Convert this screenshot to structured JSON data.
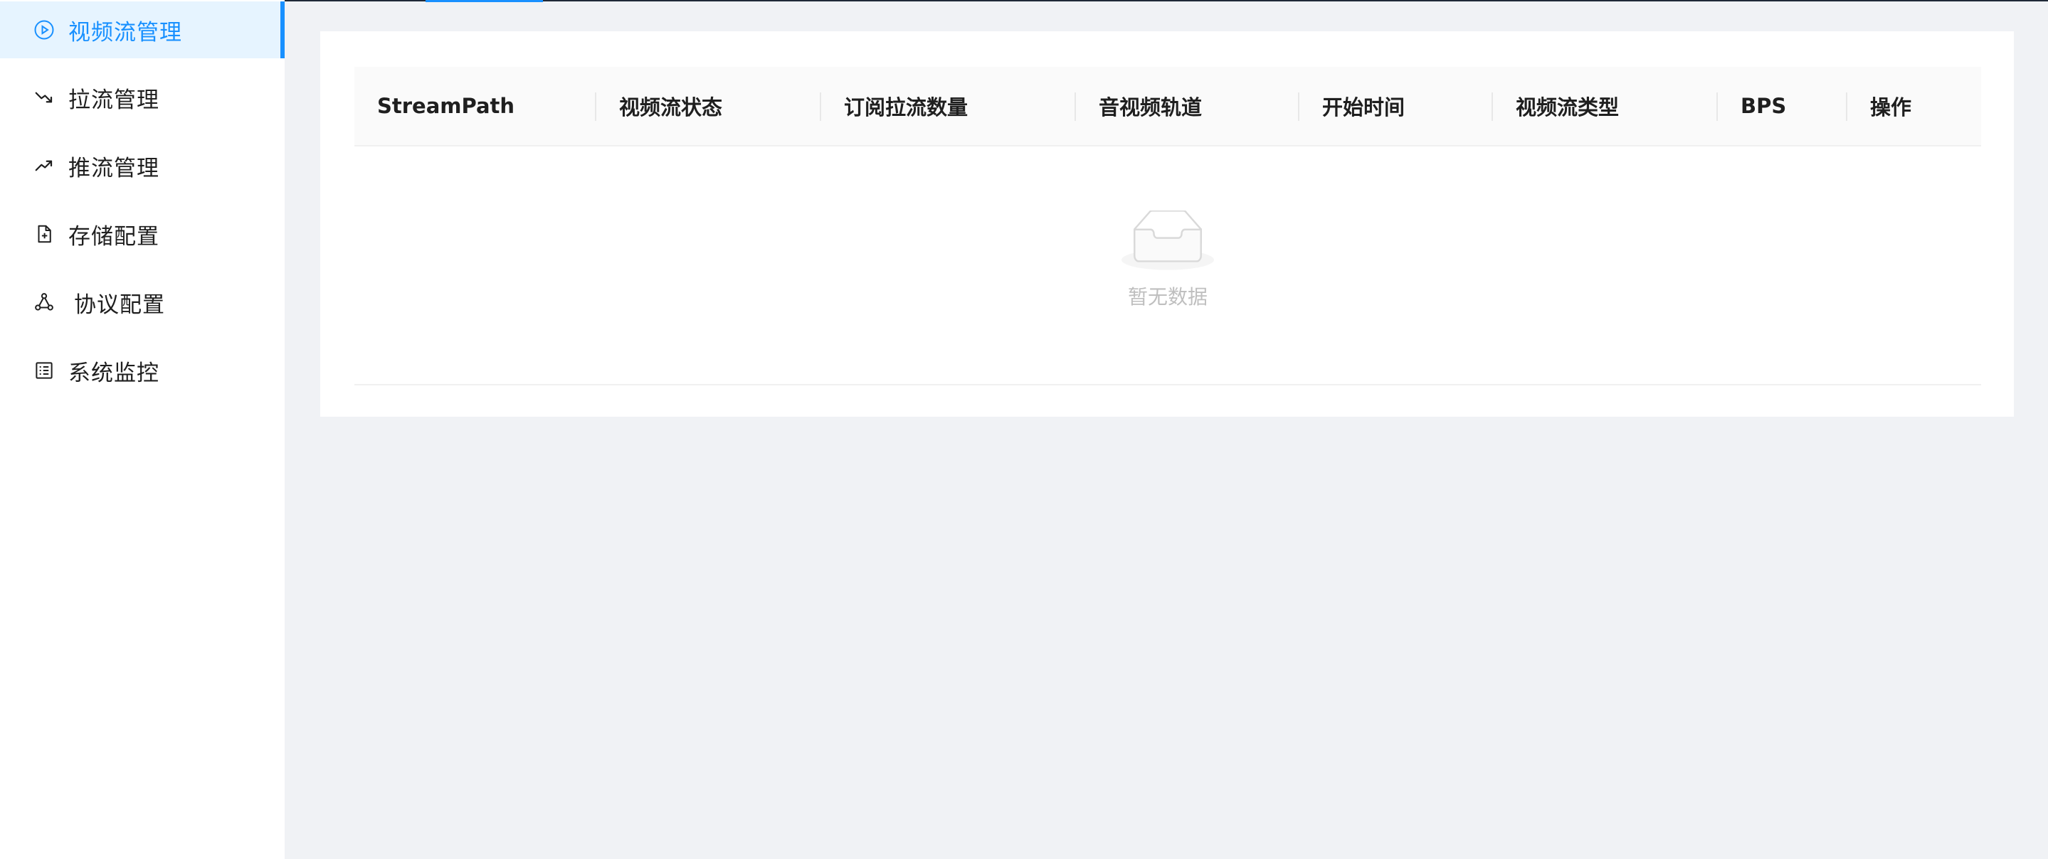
{
  "sidebar": {
    "items": [
      {
        "label": "视频流管理",
        "icon": "play-circle-icon",
        "active": true
      },
      {
        "label": "拉流管理",
        "icon": "trend-down-icon",
        "active": false
      },
      {
        "label": "推流管理",
        "icon": "trend-up-icon",
        "active": false
      },
      {
        "label": "存储配置",
        "icon": "file-add-icon",
        "active": false
      },
      {
        "label": "协议配置",
        "icon": "nodes-icon",
        "active": false
      },
      {
        "label": "系统监控",
        "icon": "list-icon",
        "active": false
      }
    ]
  },
  "table": {
    "columns": [
      "StreamPath",
      "视频流状态",
      "订阅拉流数量",
      "音视频轨道",
      "开始时间",
      "视频流类型",
      "BPS",
      "操作"
    ],
    "rows": [],
    "empty_text": "暂无数据"
  },
  "colors": {
    "accent": "#1890ff",
    "active_bg": "#e6f4ff",
    "page_bg": "#f0f2f5",
    "header_bg": "#fafafa",
    "empty_text": "#bfbfbf"
  }
}
